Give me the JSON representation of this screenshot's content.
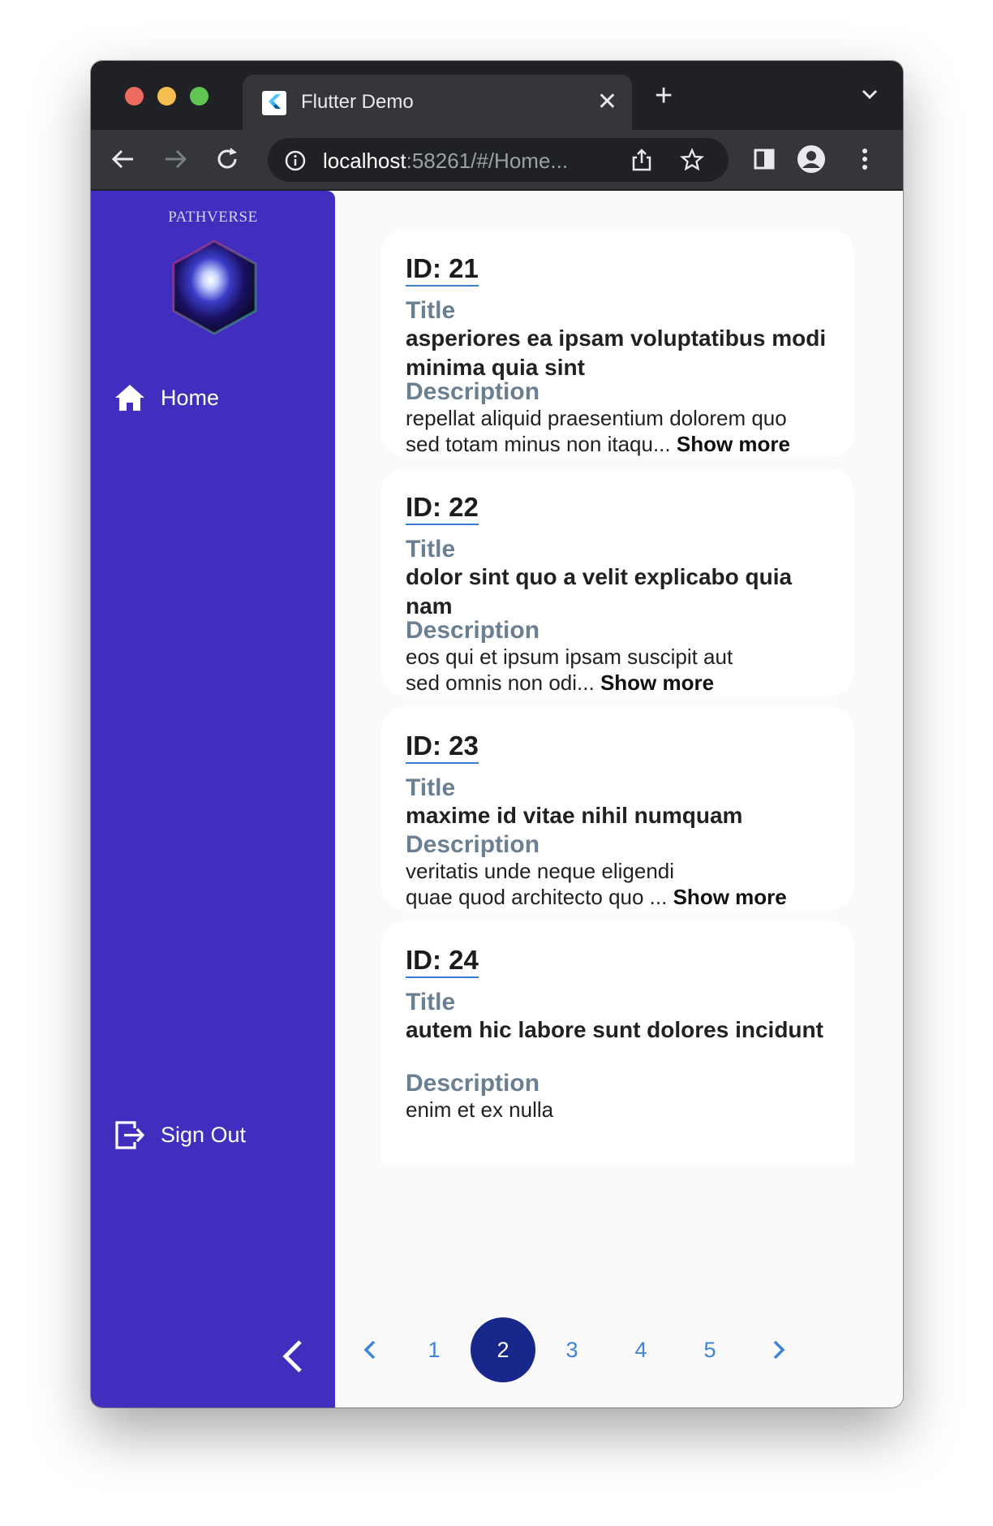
{
  "browser": {
    "tab_title": "Flutter Demo",
    "url_host": "localhost",
    "url_rest": ":58261/#/Home..."
  },
  "sidebar": {
    "brand": "PATHVERSE",
    "items": [
      {
        "label": "Home",
        "icon": "home-icon"
      },
      {
        "label": "Sign Out",
        "icon": "sign-out-icon"
      }
    ],
    "collapse_icon": "chevron-left-icon",
    "background_color": "#412dbe"
  },
  "posts": [
    {
      "id": "ID: 21",
      "title_label": "Title",
      "title": "asperiores ea ipsam voluptatibus modi minima quia sint",
      "description_label": "Description",
      "description_line1": "repellat aliquid praesentium dolorem quo",
      "description_line2": "sed totam minus non itaqu...",
      "show_more": "Show more"
    },
    {
      "id": "ID: 22",
      "title_label": "Title",
      "title": "dolor sint quo a velit explicabo quia nam",
      "description_label": "Description",
      "description_line1": "eos qui et ipsum ipsam suscipit aut",
      "description_line2": "sed omnis non odi...",
      "show_more": "Show more"
    },
    {
      "id": "ID: 23",
      "title_label": "Title",
      "title": "maxime id vitae nihil numquam",
      "description_label": "Description",
      "description_line1": "veritatis unde neque eligendi",
      "description_line2": "quae quod architecto quo ...",
      "show_more": "Show more"
    },
    {
      "id": "ID: 24",
      "title_label": "Title",
      "title": "autem hic labore sunt dolores incidunt",
      "description_label": "Description",
      "description_line1": "enim et ex nulla"
    }
  ],
  "pagination": {
    "pages": [
      "1",
      "2",
      "3",
      "4",
      "5"
    ],
    "current": "2",
    "prev_icon": "chevron-left-icon",
    "next_icon": "chevron-right-icon",
    "accent_color": "#3f84d6",
    "active_color": "#17288a"
  }
}
